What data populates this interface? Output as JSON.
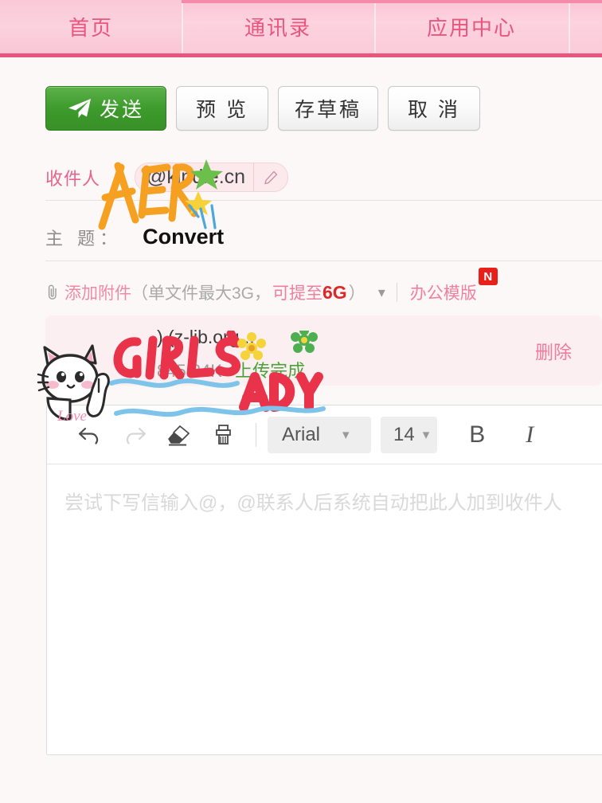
{
  "nav": {
    "tabs": [
      {
        "label": "首页",
        "name": "nav-tab-home",
        "active": true
      },
      {
        "label": "通讯录",
        "name": "nav-tab-contacts",
        "active": false
      },
      {
        "label": "应用中心",
        "name": "nav-tab-app-center",
        "active": false
      },
      {
        "label": "",
        "name": "nav-tab-overflow",
        "active": false
      }
    ]
  },
  "toolbar_actions": {
    "send_label": "发送",
    "preview_label": "预 览",
    "draft_label": "存草稿",
    "cancel_label": "取 消",
    "send_icon": "paper-plane-icon",
    "send_color": "#3d9a2c"
  },
  "fields": {
    "recipient": {
      "label": "收件人",
      "chip_value": "@kindle.cn",
      "edit_icon": "pencil-icon"
    },
    "subject": {
      "label": "主  题：",
      "value": "Convert"
    }
  },
  "attach_bar": {
    "clip_icon": "paperclip-icon",
    "add_label": "添加附件",
    "note_open": "（单文件最大3G，",
    "upgrade_prefix": "可提至",
    "upgrade_size": "6G",
    "note_close": "）",
    "caret_icon": "chevron-down-icon",
    "template_label": "办公模版",
    "badge": "N",
    "badge_color": "#e8201a"
  },
  "attachment": {
    "name": ") (z-lib.org...",
    "size": "845.84K",
    "status": "上传完成",
    "delete_label": "删除"
  },
  "editor": {
    "tools": [
      {
        "name": "undo-icon",
        "label": "undo",
        "disabled": false
      },
      {
        "name": "redo-icon",
        "label": "redo",
        "disabled": true
      },
      {
        "name": "eraser-icon",
        "label": "clear-format",
        "disabled": false
      },
      {
        "name": "format-painter-icon",
        "label": "format-painter",
        "disabled": false
      }
    ],
    "font_value": "Arial",
    "size_value": "14",
    "bold_label": "B",
    "italic_label": "I",
    "placeholder": "尝试下写信输入@，@联系人后系统自动把此人加到收件人"
  },
  "stickers": [
    {
      "name": "her-sticker",
      "text": "HER",
      "colors": [
        "#f5a020",
        "#6cbf4b",
        "#f7d13a",
        "#4aa8de"
      ]
    },
    {
      "name": "girls-day-sticker",
      "text_line1": "GIRL'S",
      "text_line2": "DAY",
      "colors": [
        "#e8334a",
        "#7ec4ea",
        "#f5d33a",
        "#4cb050"
      ]
    },
    {
      "name": "cat-love-sticker",
      "text": "Love",
      "colors": [
        "#ffffff",
        "#f7aec4",
        "#333333"
      ]
    }
  ],
  "colors": {
    "nav_pink": "#fbcbd9",
    "nav_border": "#e8557f",
    "accent_pink": "#e8567f",
    "link_pink": "#ef8aa4",
    "page_bg": "#fdf8f8"
  }
}
